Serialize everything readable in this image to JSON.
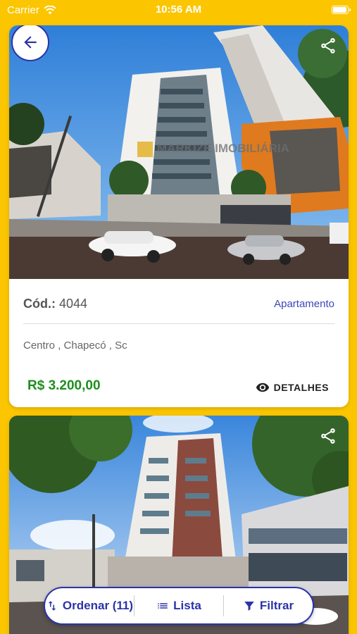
{
  "status_bar": {
    "carrier": "Carrier",
    "time": "10:56 AM",
    "battery_level": 1.0
  },
  "listings": [
    {
      "code_label": "Cód.:",
      "code": "4044",
      "type": "Apartamento",
      "location": "Centro , Chapecó , Sc",
      "price": "R$  3.200,00",
      "details_label": "DETALHES",
      "watermark": "MARKIZE IMOBILIÁRIA"
    },
    {
      "code_label": "",
      "code": "",
      "type": "",
      "location": "",
      "price": "",
      "details_label": ""
    }
  ],
  "actions": {
    "sort_label": "Ordenar (11)",
    "list_label": "Lista",
    "filter_label": "Filtrar"
  },
  "icons": {
    "back": "arrow-left-icon",
    "share": "share-icon",
    "details": "eye-icon",
    "sort": "sort-arrows-icon",
    "list": "list-icon",
    "filter": "funnel-icon"
  },
  "colors": {
    "background": "#FBC500",
    "accent": "#2B34A8",
    "price": "#1E8E1E",
    "type_link": "#3C47B8"
  }
}
